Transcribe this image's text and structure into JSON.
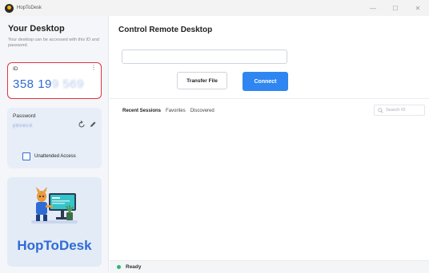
{
  "window": {
    "title": "HopToDesk",
    "controls": {
      "minimize": "—",
      "maximize": "☐",
      "close": "✕"
    }
  },
  "sidebar": {
    "title": "Your Desktop",
    "description": "Your desktop can be accessed with this ID and password.",
    "id_card": {
      "label": "ID",
      "menu_glyph": "⋮",
      "id_visible": "358 19",
      "id_obscured": "9 569"
    },
    "password_card": {
      "label": "Password",
      "value_obscured": "y8vec4",
      "unattended_label": "Unattended Access",
      "unattended_checked": false
    },
    "brand": {
      "name": "HopToDesk"
    }
  },
  "main": {
    "title": "Control Remote Desktop",
    "remote_input": {
      "value": "",
      "placeholder": ""
    },
    "transfer_label": "Transfer File",
    "connect_label": "Connect",
    "tabs": [
      {
        "label": "Recent Sessions",
        "active": true
      },
      {
        "label": "Favorites",
        "active": false
      },
      {
        "label": "Discovered",
        "active": false
      }
    ],
    "search": {
      "placeholder": "Search ID"
    }
  },
  "status": {
    "text": "Ready",
    "color": "#34b37a"
  },
  "colors": {
    "accent": "#2f86f1",
    "brand": "#2f6bd4",
    "highlight": "#e0353d"
  }
}
